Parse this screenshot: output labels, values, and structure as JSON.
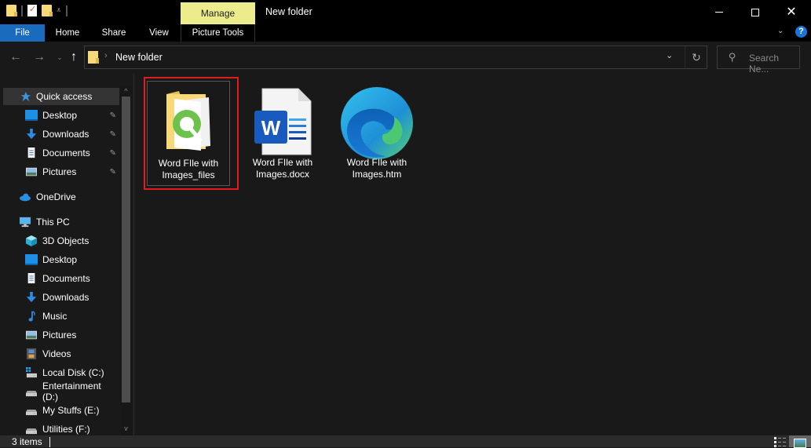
{
  "window": {
    "title": "New folder",
    "contextual_tab_group": "Manage"
  },
  "ribbon": {
    "tabs": [
      {
        "label": "File",
        "active": true
      },
      {
        "label": "Home"
      },
      {
        "label": "Share"
      },
      {
        "label": "View"
      },
      {
        "label": "Picture Tools"
      }
    ],
    "help": "?"
  },
  "navigation": {
    "back": "←",
    "forward": "→",
    "recent": "⌄",
    "up": "↑",
    "address_path": "New folder",
    "address_chevron": "›",
    "dropdown": "⌄",
    "refresh": "↻",
    "search_placeholder": "Search Ne..."
  },
  "sidebar": {
    "items": [
      {
        "label": "Quick access",
        "icon": "star-icon",
        "selected": true
      },
      {
        "label": "Desktop",
        "icon": "desktop-icon",
        "pinned": true
      },
      {
        "label": "Downloads",
        "icon": "download-icon",
        "pinned": true
      },
      {
        "label": "Documents",
        "icon": "documents-icon",
        "pinned": true
      },
      {
        "label": "Pictures",
        "icon": "pictures-icon",
        "pinned": true
      },
      {
        "label": "OneDrive",
        "icon": "cloud-icon"
      },
      {
        "label": "This PC",
        "icon": "computer-icon"
      },
      {
        "label": "3D Objects",
        "icon": "cube-icon"
      },
      {
        "label": "Desktop",
        "icon": "desktop-icon"
      },
      {
        "label": "Documents",
        "icon": "documents-icon"
      },
      {
        "label": "Downloads",
        "icon": "download-icon"
      },
      {
        "label": "Music",
        "icon": "music-icon"
      },
      {
        "label": "Pictures",
        "icon": "pictures-icon"
      },
      {
        "label": "Videos",
        "icon": "videos-icon"
      },
      {
        "label": "Local Disk (C:)",
        "icon": "system-drive-icon"
      },
      {
        "label": "Entertainment (D:)",
        "icon": "drive-icon"
      },
      {
        "label": "My Stuffs (E:)",
        "icon": "drive-icon"
      },
      {
        "label": "Utilities (F:)",
        "icon": "drive-icon"
      }
    ],
    "pin_glyph": "📌"
  },
  "files": [
    {
      "name": "Word FIle with Images_files",
      "line1": "Word FIle with",
      "line2": "Images_files",
      "type": "folder",
      "selected": true
    },
    {
      "name": "Word FIle with Images.docx",
      "line1": "Word FIle with",
      "line2": "Images.docx",
      "type": "word-document"
    },
    {
      "name": "Word FIle with Images.htm",
      "line1": "Word FIle with",
      "line2": "Images.htm",
      "type": "edge-html"
    }
  ],
  "status": {
    "item_count": "3 items"
  },
  "colors": {
    "accent": "#1a6bbd",
    "manage_tab": "#ecec8c",
    "highlight": "#e21c1c",
    "background": "#191919"
  }
}
